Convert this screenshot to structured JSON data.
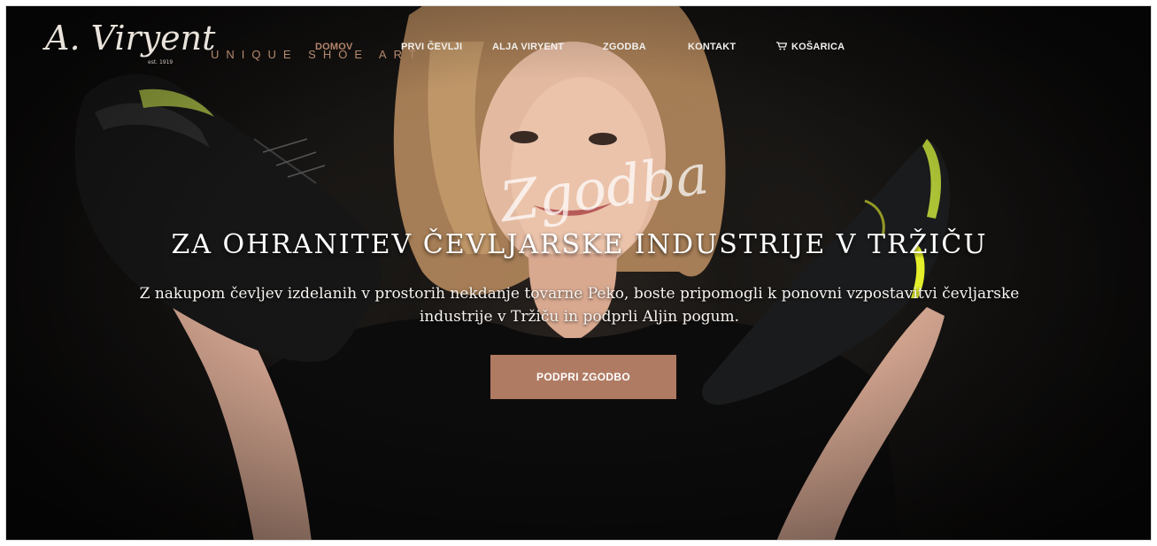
{
  "brand": {
    "logo_text": "A. Viryent",
    "est": "est. 1919",
    "tagline": "UNIQUE SHOE ART"
  },
  "nav": {
    "items": [
      {
        "label": "DOMOV",
        "active": true
      },
      {
        "label": "PRVI ČEVLJI"
      },
      {
        "label": "ALJA VIRYENT"
      },
      {
        "label": "ZGODBA"
      },
      {
        "label": "KONTAKT"
      },
      {
        "label": "KOŠARICA",
        "icon": "cart-icon"
      }
    ]
  },
  "hero": {
    "script_title": "Zgodba",
    "headline": "ZA OHRANITEV ČEVLJARSKE INDUSTRIJE V TRŽIČU",
    "subtext": "Z nakupom čevljev izdelanih v prostorih nekdanje tovarne Peko, boste pripomogli k ponovni vzpostavitvi čevljarske industrije v Tržiču in podprli Aljin pogum.",
    "cta_label": "PODPRI ZGODBO"
  },
  "colors": {
    "accent": "#b07b63",
    "nav_active": "#b5856a",
    "background": "#0c0b0a"
  }
}
